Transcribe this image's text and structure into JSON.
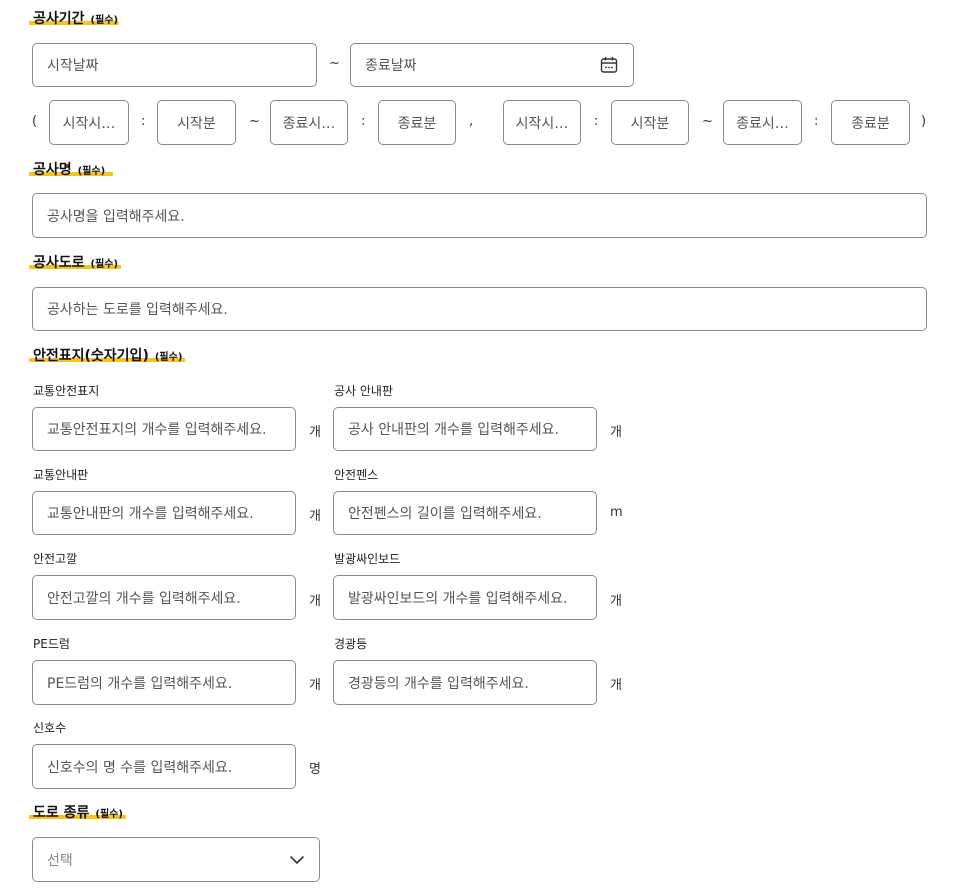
{
  "period": {
    "title": "공사기간",
    "required": "(필수)",
    "start_date_placeholder": "시작날짜",
    "date_tilde": "~",
    "end_date_placeholder": "종료날짜",
    "calendar_icon": "calendar-icon",
    "open_paren": "(",
    "close_paren": ")",
    "comma": ",",
    "colon": ":",
    "tilde": "~",
    "range1": {
      "start_hour": "시작시…",
      "start_min": "시작분",
      "end_hour": "종료시…",
      "end_min": "종료분"
    },
    "range2": {
      "start_hour": "시작시…",
      "start_min": "시작분",
      "end_hour": "종료시…",
      "end_min": "종료분"
    }
  },
  "name": {
    "title": "공사명",
    "required": "(필수)",
    "placeholder": "공사명을 입력해주세요."
  },
  "road": {
    "title": "공사도로",
    "required": "(필수)",
    "placeholder": "공사하는 도로를 입력해주세요."
  },
  "signs": {
    "title": "안전표지(숫자기입)",
    "required": "(필수)",
    "items": [
      {
        "label": "교통안전표지",
        "placeholder": "교통안전표지의 개수를 입력해주세요.",
        "unit": "개"
      },
      {
        "label": "공사 안내판",
        "placeholder": "공사 안내판의 개수를 입력해주세요.",
        "unit": "개"
      },
      {
        "label": "교통안내판",
        "placeholder": "교통안내판의 개수를 입력해주세요.",
        "unit": "개"
      },
      {
        "label": "안전펜스",
        "placeholder": "안전펜스의 길이를 입력해주세요.",
        "unit": "m"
      },
      {
        "label": "안전고깔",
        "placeholder": "안전고깔의 개수를 입력해주세요.",
        "unit": "개"
      },
      {
        "label": "발광싸인보드",
        "placeholder": "발광싸인보드의 개수를 입력해주세요.",
        "unit": "개"
      },
      {
        "label": "PE드럼",
        "placeholder": "PE드럼의 개수를 입력해주세요.",
        "unit": "개"
      },
      {
        "label": "경광등",
        "placeholder": "경광등의 개수를 입력해주세요.",
        "unit": "개"
      },
      {
        "label": "신호수",
        "placeholder": "신호수의 명 수를 입력해주세요.",
        "unit": "명"
      }
    ]
  },
  "road_type": {
    "title": "도로 종류",
    "required": "(필수)",
    "select_placeholder": "선택",
    "chevron_icon": "chevron-down-icon"
  }
}
